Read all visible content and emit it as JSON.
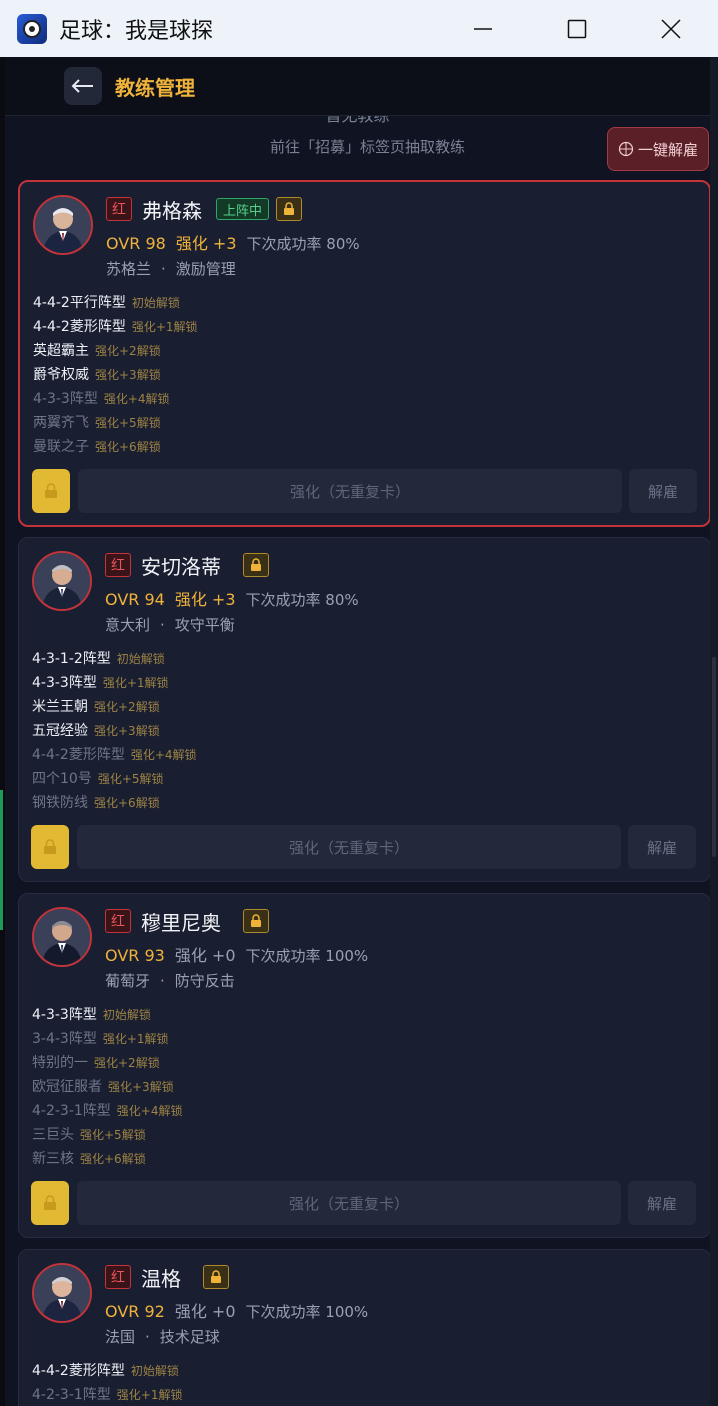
{
  "window": {
    "title": "足球：我是球探"
  },
  "header": {
    "title": "教练管理"
  },
  "hint": {
    "title": "暂无教练",
    "subtitle": "前往「招募」标签页抽取教练"
  },
  "fire_all_label": "一键解雇",
  "colors": {
    "accent": "#f0b33a",
    "red": "#c2343a",
    "green": "#2fa568"
  },
  "coaches": [
    {
      "rarity": "红",
      "name": "弗格森",
      "in_lineup": "上阵中",
      "ovr": "OVR 98",
      "enhance": "强化 +3",
      "success_rate": "下次成功率 80%",
      "nation": "苏格兰",
      "trait": "激励管理",
      "skills": [
        {
          "name": "4-4-2平行阵型",
          "unlock": "初始解锁"
        },
        {
          "name": "4-4-2菱形阵型",
          "unlock": "强化+1解锁"
        },
        {
          "name": "英超霸主",
          "unlock": "强化+2解锁"
        },
        {
          "name": "爵爷权威",
          "unlock": "强化+3解锁"
        },
        {
          "name": "4-3-3阵型",
          "unlock": "强化+4解锁"
        },
        {
          "name": "两翼齐飞",
          "unlock": "强化+5解锁"
        },
        {
          "name": "曼联之子",
          "unlock": "强化+6解锁"
        }
      ],
      "enhance_btn": "强化（无重复卡）",
      "fire_btn": "解雇"
    },
    {
      "rarity": "红",
      "name": "安切洛蒂",
      "ovr": "OVR 94",
      "enhance": "强化 +3",
      "success_rate": "下次成功率 80%",
      "nation": "意大利",
      "trait": "攻守平衡",
      "skills": [
        {
          "name": "4-3-1-2阵型",
          "unlock": "初始解锁"
        },
        {
          "name": "4-3-3阵型",
          "unlock": "强化+1解锁"
        },
        {
          "name": "米兰王朝",
          "unlock": "强化+2解锁"
        },
        {
          "name": "五冠经验",
          "unlock": "强化+3解锁"
        },
        {
          "name": "4-4-2菱形阵型",
          "unlock": "强化+4解锁"
        },
        {
          "name": "四个10号",
          "unlock": "强化+5解锁"
        },
        {
          "name": "钢铁防线",
          "unlock": "强化+6解锁"
        }
      ],
      "enhance_btn": "强化（无重复卡）",
      "fire_btn": "解雇"
    },
    {
      "rarity": "红",
      "name": "穆里尼奥",
      "ovr": "OVR 93",
      "enhance": "强化 +0",
      "success_rate": "下次成功率 100%",
      "nation": "葡萄牙",
      "trait": "防守反击",
      "skills": [
        {
          "name": "4-3-3阵型",
          "unlock": "初始解锁"
        },
        {
          "name": "3-4-3阵型",
          "unlock": "强化+1解锁"
        },
        {
          "name": "特别的一",
          "unlock": "强化+2解锁"
        },
        {
          "name": "欧冠征服者",
          "unlock": "强化+3解锁"
        },
        {
          "name": "4-2-3-1阵型",
          "unlock": "强化+4解锁"
        },
        {
          "name": "三巨头",
          "unlock": "强化+5解锁"
        },
        {
          "name": "新三核",
          "unlock": "强化+6解锁"
        }
      ],
      "enhance_btn": "强化（无重复卡）",
      "fire_btn": "解雇"
    },
    {
      "rarity": "红",
      "name": "温格",
      "ovr": "OVR 92",
      "enhance": "强化 +0",
      "success_rate": "下次成功率 100%",
      "nation": "法国",
      "trait": "技术足球",
      "skills": [
        {
          "name": "4-4-2菱形阵型",
          "unlock": "初始解锁"
        },
        {
          "name": "4-2-3-1阵型",
          "unlock": "强化+1解锁"
        }
      ]
    }
  ]
}
